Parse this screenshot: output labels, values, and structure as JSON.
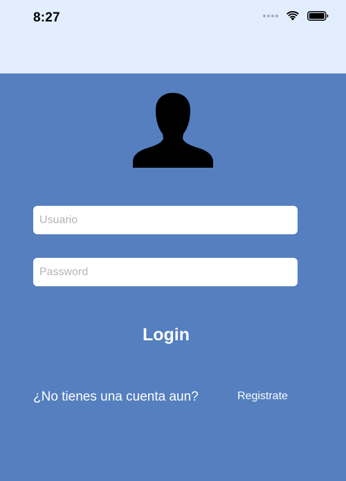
{
  "status_bar": {
    "time": "8:27",
    "icons": [
      "signal-dots-icon",
      "wifi-icon",
      "battery-icon"
    ]
  },
  "avatar": {
    "icon": "user-silhouette-icon"
  },
  "login_form": {
    "username": {
      "placeholder": "Usuario",
      "value": ""
    },
    "password": {
      "placeholder": "Password",
      "value": ""
    },
    "login_label": "Login"
  },
  "footer": {
    "no_account_text": "¿No tienes una cuenta aun?",
    "register_label": "Registrate"
  },
  "colors": {
    "background": "#557fbf",
    "status_bar_background": "#e2eefe",
    "input_background": "#ffffff",
    "text_light": "#ffffff",
    "placeholder": "#b4b4b8"
  }
}
